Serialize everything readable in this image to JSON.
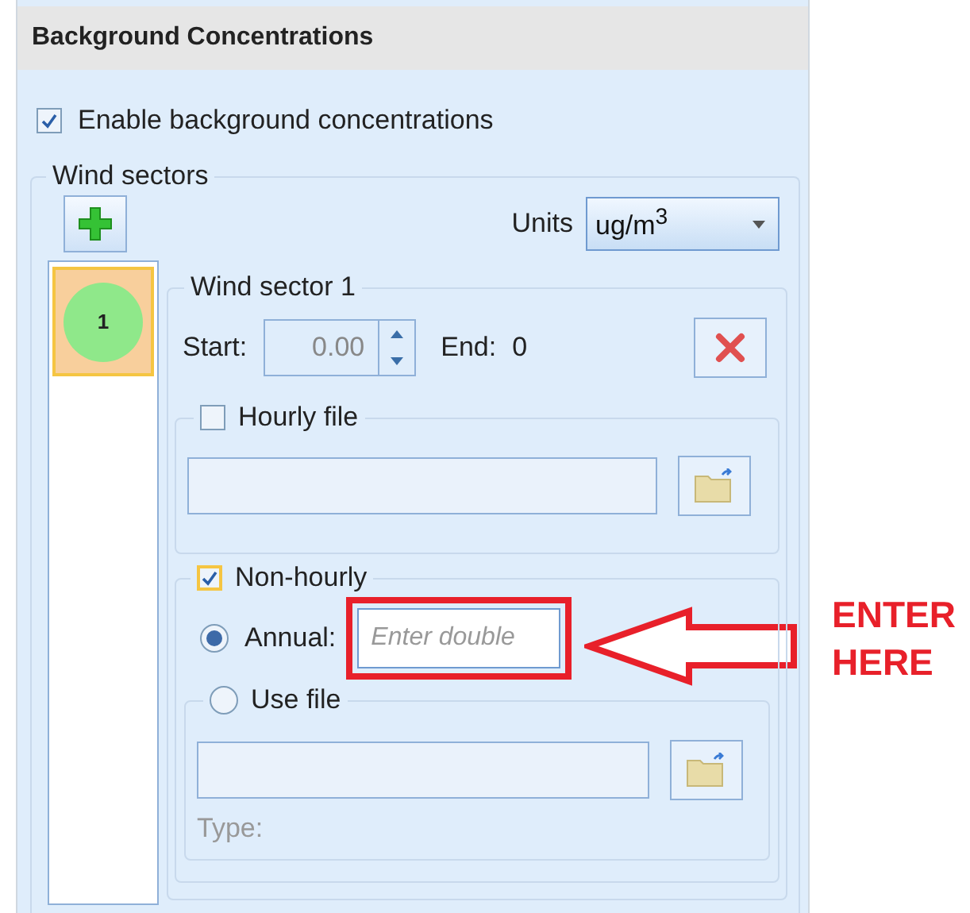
{
  "panel": {
    "title": "Background Concentrations"
  },
  "enable_background": {
    "label": "Enable background concentrations",
    "checked": true
  },
  "wind_sectors": {
    "legend": "Wind sectors",
    "units_label": "Units",
    "units_value": "ug/m$^{3}$",
    "sectors": [
      {
        "label": "1",
        "selected": true
      }
    ]
  },
  "sector": {
    "legend": "Wind sector 1",
    "start_label": "Start:",
    "start_value": "0.00",
    "end_label": "End:",
    "end_value": "0",
    "hourly_file": {
      "label": "Hourly file",
      "checked": false
    },
    "non_hourly": {
      "label": "Non-hourly",
      "checked": true,
      "options": [
        {
          "kind": "annual",
          "label": "Annual:",
          "selected": true,
          "placeholder": "Enter double"
        },
        {
          "kind": "file",
          "label": "Use file",
          "selected": false
        }
      ],
      "type_label": "Type:"
    }
  },
  "annotation": {
    "text": "ENTER HERE"
  }
}
